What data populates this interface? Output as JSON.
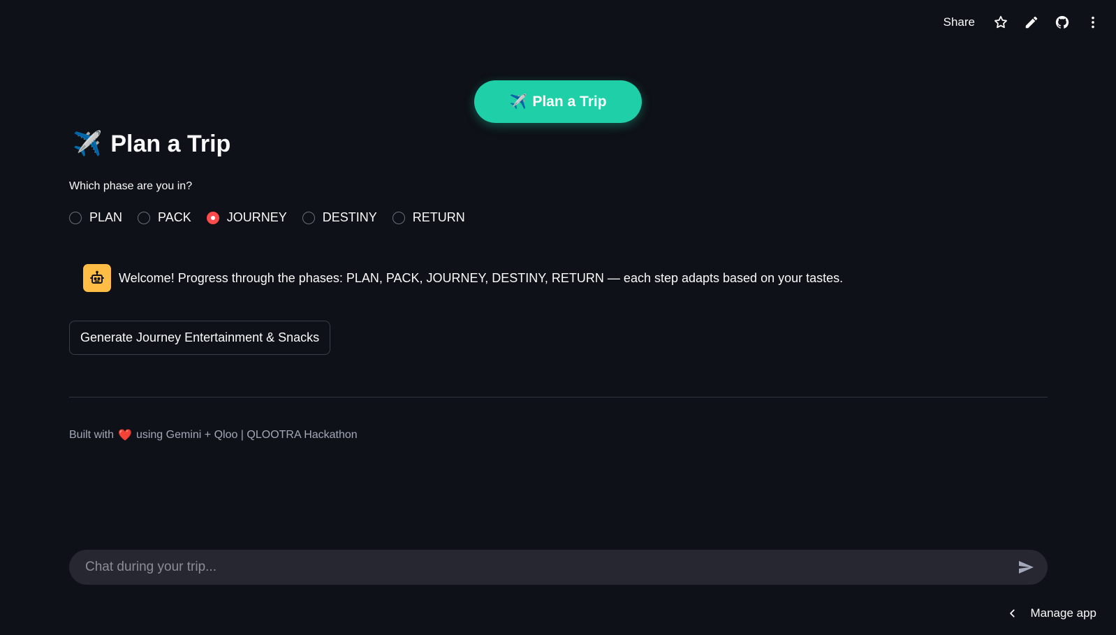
{
  "toolbar": {
    "share_label": "Share",
    "icons": [
      "star-icon",
      "pencil-icon",
      "github-icon",
      "more-vertical-icon"
    ]
  },
  "hero": {
    "emoji": "✈️",
    "label": "Plan a Trip",
    "color": "#1ecfa8"
  },
  "page": {
    "title_emoji": "✈️",
    "title": "Plan a Trip",
    "phase_question": "Which phase are you in?"
  },
  "phases": {
    "options": [
      "PLAN",
      "PACK",
      "JOURNEY",
      "DESTINY",
      "RETURN"
    ],
    "selected": "JOURNEY",
    "selected_color": "#ff4b4b"
  },
  "welcome": {
    "avatar_icon": "robot-icon",
    "avatar_color": "#ffbd45",
    "text": "Welcome! Progress through the phases: PLAN, PACK, JOURNEY, DESTINY, RETURN — each step adapts based on your tastes."
  },
  "actions": {
    "generate_label": "Generate Journey Entertainment & Snacks"
  },
  "footer": {
    "prefix": "Built with",
    "heart": "❤️",
    "suffix": "using Gemini + Qloo | QLOOTRA Hackathon"
  },
  "chat": {
    "placeholder": "Chat during your trip..."
  },
  "manage": {
    "label": "Manage app"
  },
  "theme": {
    "background": "#0e1117",
    "text": "#fafafa"
  }
}
